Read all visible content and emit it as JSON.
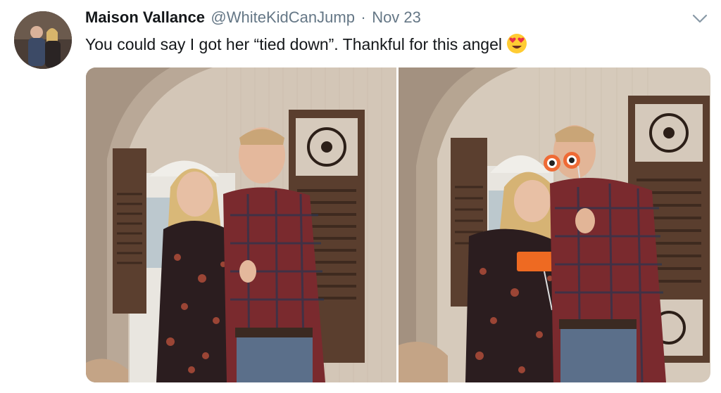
{
  "tweet": {
    "display_name": "Maison Vallance",
    "handle": "@WhiteKidCanJump",
    "separator": "·",
    "date": "Nov 23",
    "text": "You could say I got her “tied down”. Thankful for this angel",
    "emoji": "heart-eyes-emoji",
    "menu_icon": "chevron-down-icon",
    "photos": [
      {
        "sign_text": ""
      },
      {
        "sign_text": ""
      }
    ]
  },
  "colors": {
    "name": "#14171a",
    "meta": "#657786",
    "wall": "#cfc2b4",
    "shutter": "#5a3e2e",
    "plaid": "#7a2a2e",
    "sign": "#ee6a22"
  }
}
